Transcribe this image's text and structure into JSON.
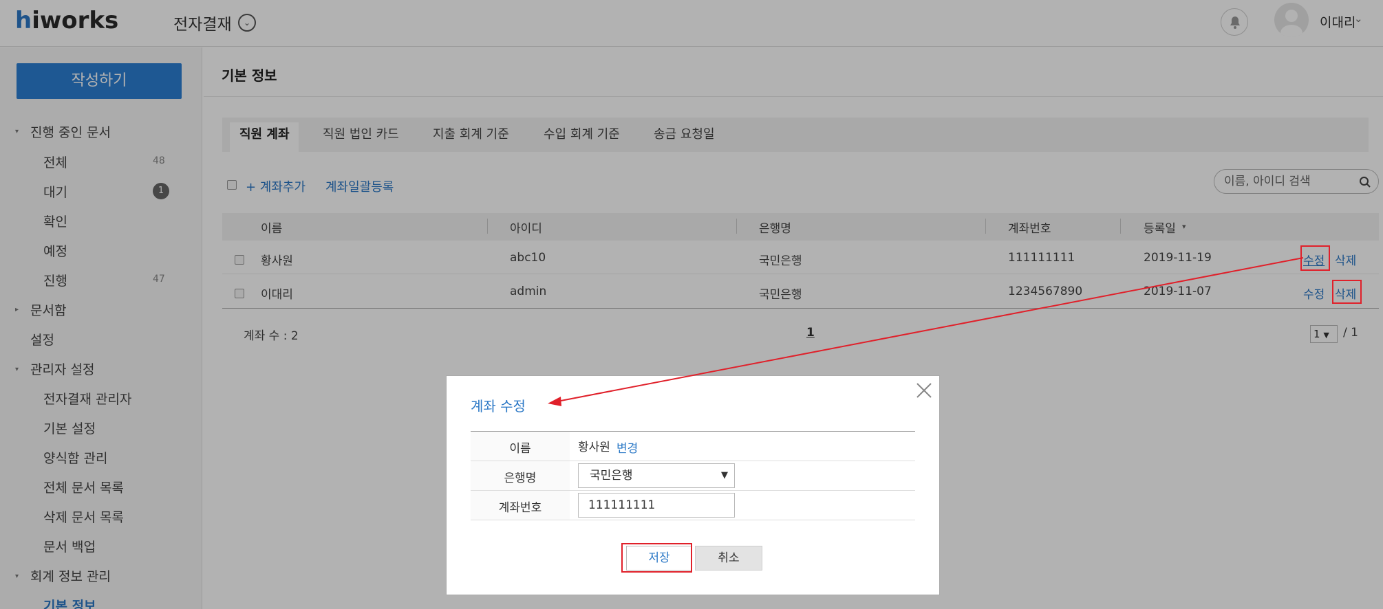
{
  "header": {
    "logo_h": "h",
    "logo_rest": "iworks",
    "app_title": "전자결재",
    "user_name": "이대리"
  },
  "sidebar": {
    "compose": "작성하기",
    "in_progress": "진행 중인 문서",
    "all": "전체",
    "all_count": "48",
    "waiting": "대기",
    "waiting_count": "1",
    "confirm": "확인",
    "scheduled": "예정",
    "progress": "진행",
    "progress_count": "47",
    "docbox": "문서함",
    "settings": "설정",
    "admin_settings": "관리자 설정",
    "approval_admin": "전자결재 관리자",
    "basic_settings": "기본 설정",
    "form_manage": "양식함 관리",
    "all_docs": "전체 문서 목록",
    "deleted_docs": "삭제 문서 목록",
    "doc_backup": "문서 백업",
    "account_info": "회계 정보 관리",
    "basic_info": "기본 정보"
  },
  "main": {
    "title": "기본 정보",
    "tabs": [
      "직원 계좌",
      "직원 법인 카드",
      "지출 회계 기준",
      "수입 회계 기준",
      "송금 요청일"
    ],
    "add_account": "+ 계좌추가",
    "bulk_register": "계좌일괄등록",
    "search_placeholder": "이름, 아이디 검색",
    "columns": [
      "이름",
      "아이디",
      "은행명",
      "계좌번호",
      "등록일"
    ],
    "rows": [
      {
        "name": "황사원",
        "id": "abc10",
        "bank": "국민은행",
        "account": "111111111",
        "date": "2019-11-19",
        "edit": "수정",
        "delete": "삭제"
      },
      {
        "name": "이대리",
        "id": "admin",
        "bank": "국민은행",
        "account": "1234567890",
        "date": "2019-11-07",
        "edit": "수정",
        "delete": "삭제"
      }
    ],
    "account_count": "계좌 수 : 2",
    "page": "1",
    "page_select": "1",
    "page_total": "/ 1"
  },
  "modal": {
    "title": "계좌 수정",
    "name_label": "이름",
    "name_value": "황사원",
    "change_link": "변경",
    "bank_label": "은행명",
    "bank_value": "국민은행",
    "account_label": "계좌번호",
    "account_value": "111111111",
    "save": "저장",
    "cancel": "취소"
  },
  "colors": {
    "accent": "#2b78c6",
    "compose": "#2b7ed3",
    "annotation": "#e0202a"
  }
}
